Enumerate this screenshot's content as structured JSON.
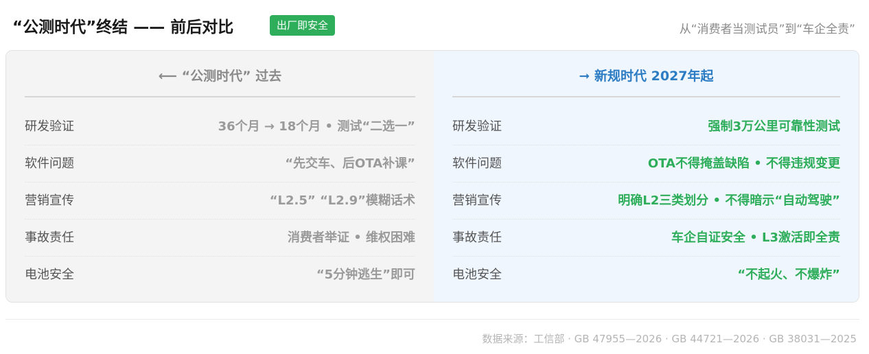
{
  "header": {
    "title": "“公测时代”终结 —— 前后对比",
    "badge": "出厂即安全",
    "subtitle": "从“消费者当测试员”到“车企全责”"
  },
  "left_panel": {
    "heading": "⟵ “公测时代” 过去",
    "rows": [
      {
        "label": "研发验证",
        "value": "36个月 → 18个月 • 测试“二选一”"
      },
      {
        "label": "软件问题",
        "value": "“先交车、后OTA补课”"
      },
      {
        "label": "营销宣传",
        "value": "“L2.5” “L2.9”模糊话术"
      },
      {
        "label": "事故责任",
        "value": "消费者举证 • 维权困难"
      },
      {
        "label": "电池安全",
        "value": "“5分钟逃生”即可"
      }
    ]
  },
  "right_panel": {
    "heading": "➞ 新规时代 2027年起",
    "rows": [
      {
        "label": "研发验证",
        "value": "强制3万公里可靠性测试"
      },
      {
        "label": "软件问题",
        "value": "OTA不得掩盖缺陷 • 不得违规变更"
      },
      {
        "label": "营销宣传",
        "value": "明确L2三类划分 • 不得暗示“自动驾驶”"
      },
      {
        "label": "事故责任",
        "value": "车企自证安全 • L3激活即全责"
      },
      {
        "label": "电池安全",
        "value": "“不起火、不爆炸”"
      }
    ]
  },
  "footer": {
    "source": "数据来源：工信部 · GB 47955—2026 · GB 44721—2026 · GB 38031—2025"
  },
  "colors": {
    "badge": "#2eae5a",
    "right_heading": "#2c7cc4",
    "right_values": "#2eae5a",
    "left_values": "#9a9a9a",
    "left_bg": "#f4f4f4",
    "right_bg": "#eff6fe"
  }
}
